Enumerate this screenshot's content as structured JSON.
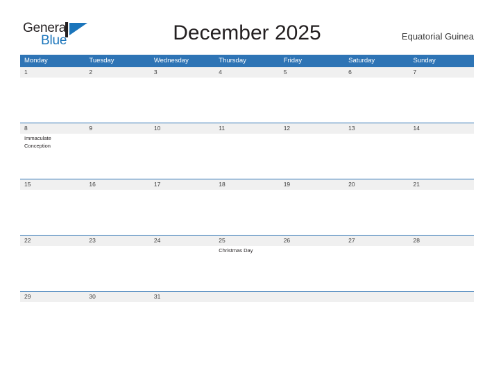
{
  "brand": {
    "name_part1": "General",
    "name_part2": "Blue",
    "flag_icon": "blue-flag-triangle-icon",
    "accent_color": "#1b75bb"
  },
  "header": {
    "title": "December 2025",
    "country": "Equatorial Guinea"
  },
  "calendar": {
    "header_bg_color": "#2e74b5",
    "day_banner_color": "#f0f0f0",
    "weekdays": [
      "Monday",
      "Tuesday",
      "Wednesday",
      "Thursday",
      "Friday",
      "Saturday",
      "Sunday"
    ],
    "weeks": [
      {
        "days": [
          {
            "number": "1",
            "events": []
          },
          {
            "number": "2",
            "events": []
          },
          {
            "number": "3",
            "events": []
          },
          {
            "number": "4",
            "events": []
          },
          {
            "number": "5",
            "events": []
          },
          {
            "number": "6",
            "events": []
          },
          {
            "number": "7",
            "events": []
          }
        ]
      },
      {
        "days": [
          {
            "number": "8",
            "events": [
              "Immaculate Conception"
            ]
          },
          {
            "number": "9",
            "events": []
          },
          {
            "number": "10",
            "events": []
          },
          {
            "number": "11",
            "events": []
          },
          {
            "number": "12",
            "events": []
          },
          {
            "number": "13",
            "events": []
          },
          {
            "number": "14",
            "events": []
          }
        ]
      },
      {
        "days": [
          {
            "number": "15",
            "events": []
          },
          {
            "number": "16",
            "events": []
          },
          {
            "number": "17",
            "events": []
          },
          {
            "number": "18",
            "events": []
          },
          {
            "number": "19",
            "events": []
          },
          {
            "number": "20",
            "events": []
          },
          {
            "number": "21",
            "events": []
          }
        ]
      },
      {
        "days": [
          {
            "number": "22",
            "events": []
          },
          {
            "number": "23",
            "events": []
          },
          {
            "number": "24",
            "events": []
          },
          {
            "number": "25",
            "events": [
              "Christmas Day"
            ]
          },
          {
            "number": "26",
            "events": []
          },
          {
            "number": "27",
            "events": []
          },
          {
            "number": "28",
            "events": []
          }
        ]
      },
      {
        "days": [
          {
            "number": "29",
            "events": []
          },
          {
            "number": "30",
            "events": []
          },
          {
            "number": "31",
            "events": []
          },
          {
            "number": "",
            "events": []
          },
          {
            "number": "",
            "events": []
          },
          {
            "number": "",
            "events": []
          },
          {
            "number": "",
            "events": []
          }
        ]
      }
    ]
  }
}
